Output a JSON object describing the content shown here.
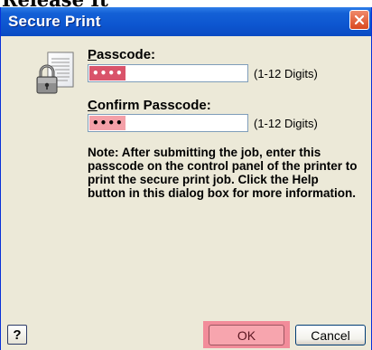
{
  "header_crop": {
    "text": "Release It"
  },
  "window": {
    "title": "Secure Print",
    "close_glyph": "✕"
  },
  "icons": {
    "lock": "lock-document-icon",
    "close": "close-icon",
    "help": "help-icon"
  },
  "form": {
    "passcode": {
      "label_accel": "P",
      "label_rest": "asscode:",
      "value": "••••",
      "hint": "(1-12 Digits)"
    },
    "confirm_passcode": {
      "label_accel": "C",
      "label_rest": "onfirm Passcode:",
      "value": "••••",
      "hint": "(1-12 Digits)"
    }
  },
  "note": {
    "text": "Note: After submitting the job, enter this passcode on the control panel of the printer to print the secure print job.  Click the Help button in this dialog box for more information."
  },
  "buttons": {
    "help_label": "?",
    "ok_label": "OK",
    "cancel_label": "Cancel"
  },
  "colors": {
    "titlebar": "#0d56d0",
    "dialog_bg": "#ece9d8",
    "highlight": "#f28c9a",
    "close_button": "#d9481f"
  }
}
